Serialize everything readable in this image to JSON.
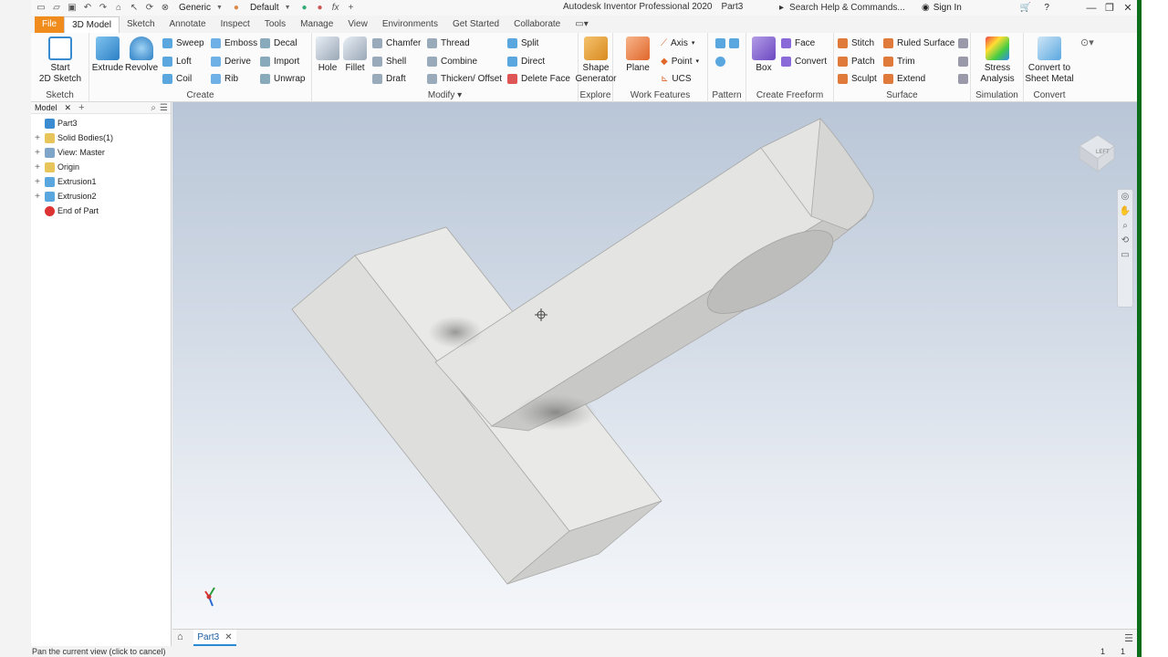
{
  "titlebar": {
    "app_title": "Autodesk Inventor Professional 2020",
    "doc_title": "Part3",
    "material_select": "Generic",
    "appearance_select": "Default",
    "search_placeholder": "Search Help & Commands...",
    "sign_in": "Sign In"
  },
  "tabs": [
    "File",
    "3D Model",
    "Sketch",
    "Annotate",
    "Inspect",
    "Tools",
    "Manage",
    "View",
    "Environments",
    "Get Started",
    "Collaborate"
  ],
  "ribbon": {
    "sketch": {
      "start_sketch_line1": "Start",
      "start_sketch_line2": "2D Sketch",
      "title": "Sketch"
    },
    "create": {
      "extrude": "Extrude",
      "revolve": "Revolve",
      "sweep": "Sweep",
      "emboss": "Emboss",
      "decal": "Decal",
      "loft": "Loft",
      "derive": "Derive",
      "import": "Import",
      "coil": "Coil",
      "rib": "Rib",
      "unwrap": "Unwrap",
      "title": "Create"
    },
    "modify": {
      "hole": "Hole",
      "fillet": "Fillet",
      "chamfer": "Chamfer",
      "thread": "Thread",
      "split": "Split",
      "shell": "Shell",
      "combine": "Combine",
      "direct": "Direct",
      "draft": "Draft",
      "thicken": "Thicken/ Offset",
      "delete_face": "Delete Face",
      "title": "Modify"
    },
    "explore": {
      "shape_gen_line1": "Shape",
      "shape_gen_line2": "Generator",
      "title": "Explore"
    },
    "work_features": {
      "plane": "Plane",
      "axis": "Axis",
      "point": "Point",
      "ucs": "UCS",
      "title": "Work Features"
    },
    "pattern": {
      "title": "Pattern"
    },
    "freeform": {
      "box": "Box",
      "face": "Face",
      "convert": "Convert",
      "title": "Create Freeform"
    },
    "surface": {
      "stitch": "Stitch",
      "ruled_surface": "Ruled Surface",
      "patch": "Patch",
      "trim": "Trim",
      "sculpt": "Sculpt",
      "extend": "Extend",
      "title": "Surface"
    },
    "simulation": {
      "stress_line1": "Stress",
      "stress_line2": "Analysis",
      "title": "Simulation"
    },
    "convert": {
      "sheet_line1": "Convert to",
      "sheet_line2": "Sheet Metal",
      "title": "Convert"
    }
  },
  "browser": {
    "tab_label": "Model",
    "items": [
      {
        "label": "Part3",
        "expander": ""
      },
      {
        "label": "Solid Bodies(1)",
        "expander": "+"
      },
      {
        "label": "View: Master",
        "expander": "+"
      },
      {
        "label": "Origin",
        "expander": "+"
      },
      {
        "label": "Extrusion1",
        "expander": "+"
      },
      {
        "label": "Extrusion2",
        "expander": "+"
      },
      {
        "label": "End of Part",
        "expander": ""
      }
    ]
  },
  "viewcube": {
    "face_label": "LEFT"
  },
  "doc_tabs": [
    {
      "label": "Part3"
    }
  ],
  "status": {
    "message": "Pan the current view (click to cancel)",
    "num1": "1",
    "num2": "1"
  },
  "colors": {
    "file_tab": "#f08c1e",
    "part_face_light": "#ececea",
    "part_face_mid": "#d6d6d4",
    "part_face_dark": "#b9b9b7",
    "status_edge": "#0c6e1a"
  }
}
